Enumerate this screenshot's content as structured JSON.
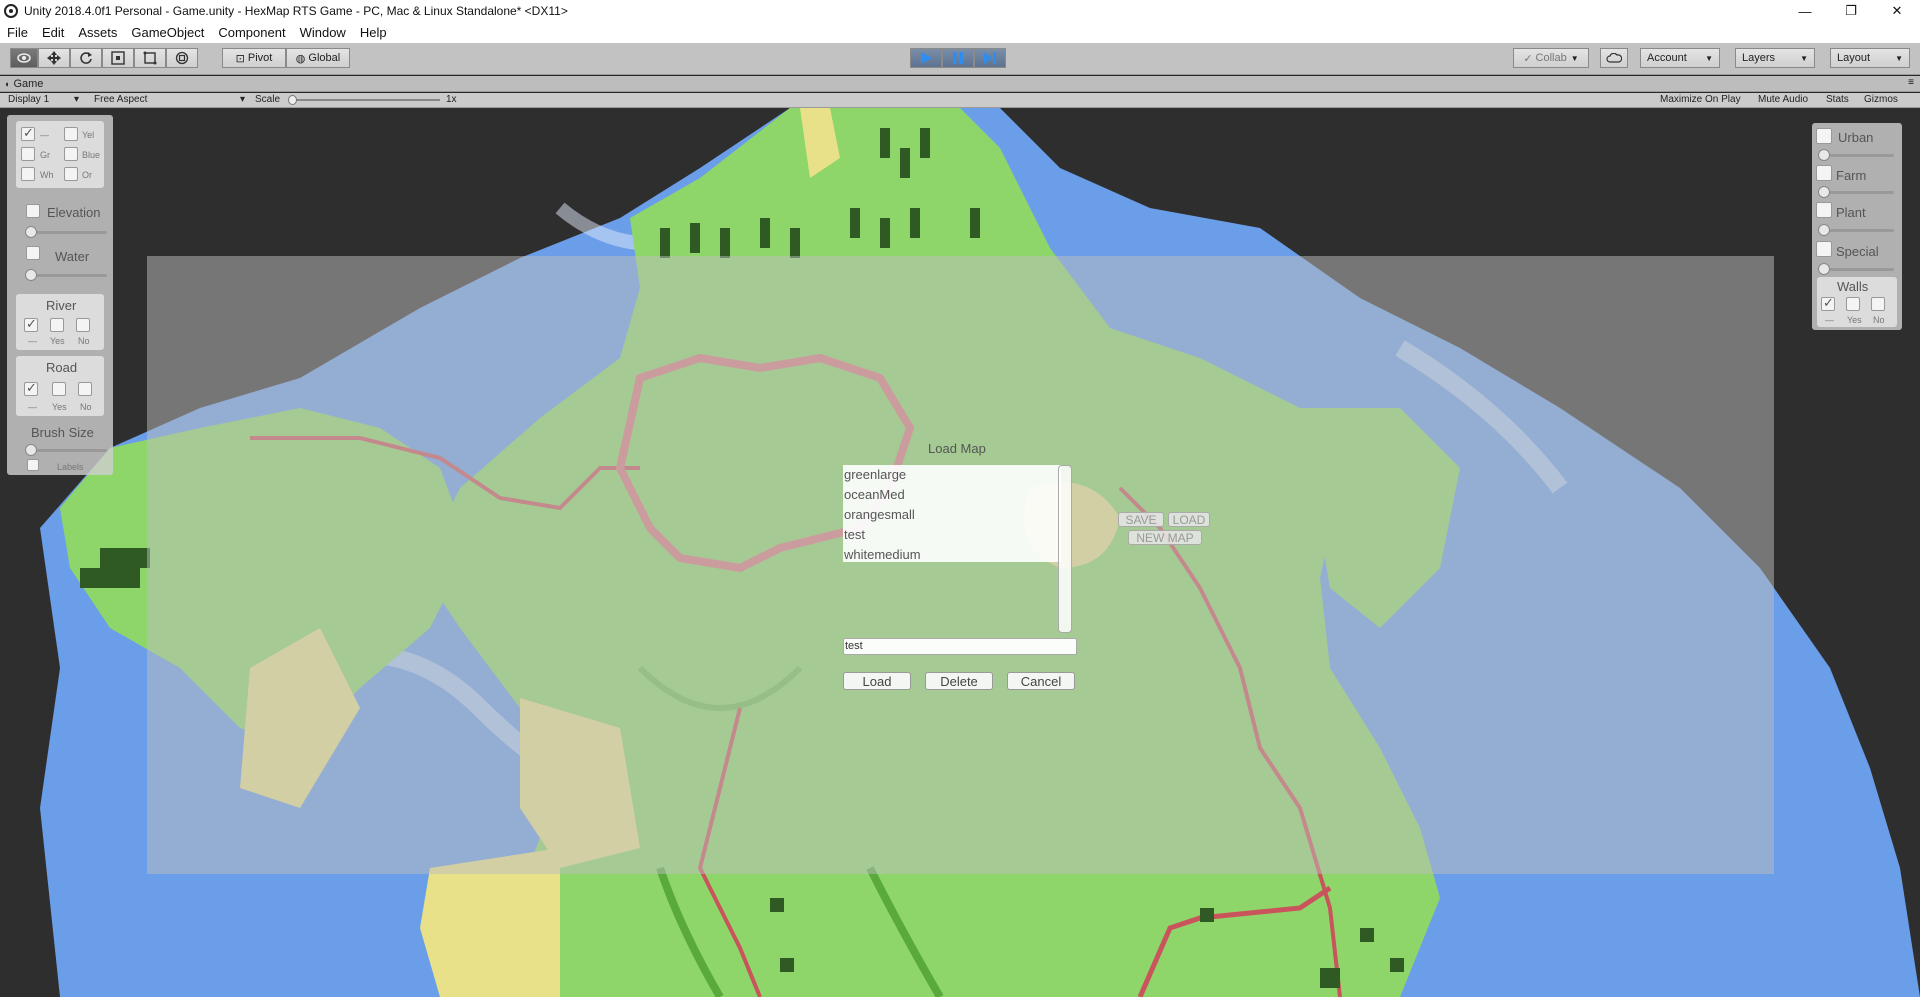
{
  "window": {
    "title": "Unity 2018.4.0f1 Personal - Game.unity - HexMap RTS Game - PC, Mac & Linux Standalone* <DX11>",
    "minimize": "—",
    "maximize": "❐",
    "close": "✕"
  },
  "menu": [
    "File",
    "Edit",
    "Assets",
    "GameObject",
    "Component",
    "Window",
    "Help"
  ],
  "toolbar": {
    "pivot": "Pivot",
    "global": "Global",
    "collab": "Collab",
    "account": "Account",
    "layers": "Layers",
    "layout": "Layout"
  },
  "game_tab": {
    "title": "Game",
    "display": "Display 1",
    "aspect": "Free Aspect",
    "scale_label": "Scale",
    "scale_value": "1x",
    "maximize_on_play": "Maximize On Play",
    "mute_audio": "Mute Audio",
    "stats": "Stats",
    "gizmos": "Gizmos"
  },
  "left_panel": {
    "colors": [
      "—",
      "Yel",
      "Gr",
      "Blue",
      "Wh",
      "Or"
    ],
    "elevation": "Elevation",
    "water": "Water",
    "river": {
      "title": "River",
      "opt_none": "—",
      "opt_yes": "Yes",
      "opt_no": "No"
    },
    "road": {
      "title": "Road",
      "opt_none": "—",
      "opt_yes": "Yes",
      "opt_no": "No"
    },
    "brush_size": "Brush Size",
    "labels": "Labels"
  },
  "right_panel": {
    "urban": "Urban",
    "farm": "Farm",
    "plant": "Plant",
    "special": "Special",
    "walls": {
      "title": "Walls",
      "opt_none": "—",
      "opt_yes": "Yes",
      "opt_no": "No"
    }
  },
  "load_dialog": {
    "title": "Load Map",
    "maps": [
      "greenlarge",
      "oceanMed",
      "orangesmall",
      "test",
      "whitemedium"
    ],
    "name_value": "test",
    "load": "Load",
    "delete": "Delete",
    "cancel": "Cancel",
    "save_small": "SAVE",
    "load_small": "LOAD",
    "new_map": "NEW MAP"
  },
  "colors": {
    "toolbar": "#c2c2c2",
    "play_blue": "#2f8df0",
    "grass": "#8fd66a",
    "water": "#6a9ee8",
    "sand": "#e9e08a",
    "road": "#c9545c"
  }
}
